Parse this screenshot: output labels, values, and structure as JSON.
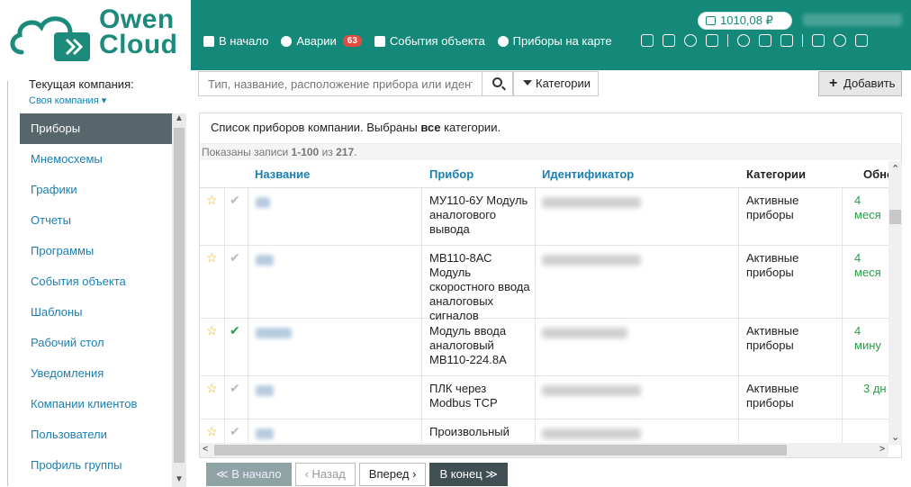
{
  "brand": {
    "line1": "Owen",
    "line2": "Cloud"
  },
  "header": {
    "balance": "1010,08 ₽",
    "nav": [
      {
        "label": "В начало",
        "icon": "home-icon"
      },
      {
        "label": "Аварии",
        "icon": "alert-icon",
        "badge": "63"
      },
      {
        "label": "События объекта",
        "icon": "events-icon"
      },
      {
        "label": "Приборы на карте",
        "icon": "map-pin-icon"
      }
    ]
  },
  "company": {
    "label": "Текущая компания:",
    "selected": "Своя компания ▾"
  },
  "menu": [
    "Приборы",
    "Мнемосхемы",
    "Графики",
    "Отчеты",
    "Программы",
    "События объекта",
    "Шаблоны",
    "Рабочий стол",
    "Уведомления",
    "Компании клиентов",
    "Пользователи",
    "Профиль группы"
  ],
  "search": {
    "placeholder": "Тип, название, расположение прибора или идентик"
  },
  "buttons": {
    "categories": "Категории",
    "add": "Добавить"
  },
  "panel": {
    "title_pre": "Список приборов компании.  Выбраны ",
    "title_bold": "все",
    "title_post": " категории.",
    "shown_pre": "Показаны записи ",
    "shown_range": "1-100",
    "shown_mid": " из ",
    "shown_total": "217",
    "shown_end": "."
  },
  "table": {
    "columns": [
      "Название",
      "Прибор",
      "Идентификатор",
      "Категории",
      "Обнов"
    ],
    "rows": [
      {
        "device": "МУ110-6У Модуль аналогового вывода",
        "category": "Активные приборы",
        "updated": "4 меся",
        "checked": false
      },
      {
        "device": "МВ110-8АС Модуль скоростного ввода аналоговых сигналов",
        "category": "Активные приборы",
        "updated": "4 меся",
        "checked": false
      },
      {
        "device": "Модуль ввода аналоговый МВ110-224.8А",
        "category": "Активные приборы",
        "updated": "4 мину",
        "checked": true
      },
      {
        "device": "ПЛК через Modbus TCP",
        "category": "Активные приборы",
        "updated": "3 дн",
        "checked": false
      },
      {
        "device": "Произвольный",
        "category": "",
        "updated": "",
        "checked": false
      }
    ]
  },
  "pager": {
    "first": "≪ В начало",
    "prev": "‹ Назад",
    "next": "Вперед ›",
    "last": "В конец ≫"
  }
}
